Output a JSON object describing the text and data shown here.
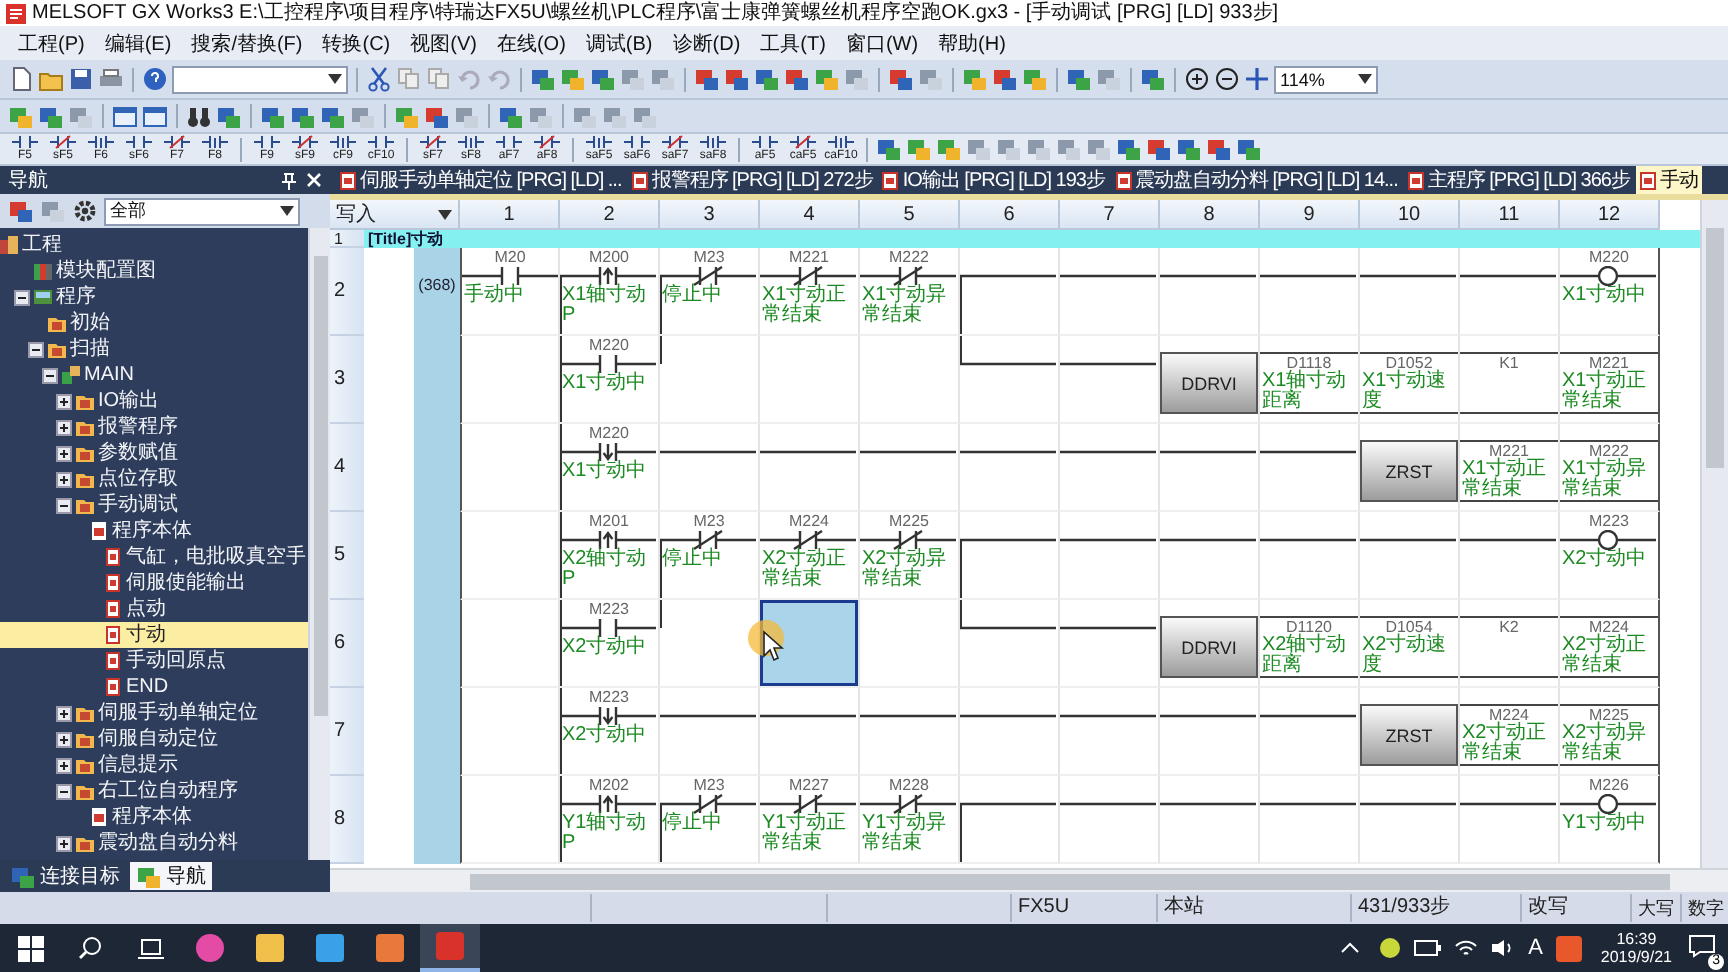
{
  "title_bar": {
    "title": "MELSOFT GX Works3 E:\\工控程序\\项目程序\\特瑞达FX5U\\螺丝机\\PLC程序\\富士康弹簧螺丝机程序空跑OK.gx3 - [手动调试 [PRG] [LD] 933步]"
  },
  "menu": [
    "工程(P)",
    "编辑(E)",
    "搜索/替换(F)",
    "转换(C)",
    "视图(V)",
    "在线(O)",
    "调试(B)",
    "诊断(D)",
    "工具(T)",
    "窗口(W)",
    "帮助(H)"
  ],
  "toolbar": {
    "zoom": "114%",
    "function_keys": [
      "F5",
      "sF5",
      "F6",
      "sF6",
      "F7",
      "F8",
      "F9",
      "sF9",
      "cF9",
      "cF10",
      "sF7",
      "sF8",
      "aF7",
      "aF8",
      "saF5",
      "saF6",
      "saF7",
      "saF8",
      "aF5",
      "caF5",
      "caF10"
    ]
  },
  "navigator": {
    "title": "导航",
    "filter": "全部",
    "tree": [
      {
        "label": "工程",
        "kind": "project",
        "selected": false,
        "children": [
          {
            "label": "模块配置图",
            "kind": "module",
            "selected": false
          },
          {
            "label": "程序",
            "kind": "programs",
            "expanded": true,
            "selected": false,
            "children": [
              {
                "label": "初始",
                "kind": "folder",
                "selected": false
              },
              {
                "label": "扫描",
                "kind": "folder",
                "expanded": true,
                "selected": false,
                "children": [
                  {
                    "label": "MAIN",
                    "kind": "main",
                    "expanded": true,
                    "selected": false,
                    "children": [
                      {
                        "label": "IO输出",
                        "kind": "folder",
                        "expanded": false,
                        "selected": false
                      },
                      {
                        "label": "报警程序",
                        "kind": "folder",
                        "expanded": false,
                        "selected": false
                      },
                      {
                        "label": "参数赋值",
                        "kind": "folder",
                        "expanded": false,
                        "selected": false
                      },
                      {
                        "label": "点位存取",
                        "kind": "folder",
                        "expanded": false,
                        "selected": false
                      },
                      {
                        "label": "手动调试",
                        "kind": "folder",
                        "expanded": true,
                        "selected": false,
                        "children": [
                          {
                            "label": "程序本体",
                            "kind": "program",
                            "selected": false,
                            "children": [
                              {
                                "label": "气缸，电批吸真空手",
                                "kind": "page",
                                "selected": false
                              },
                              {
                                "label": "伺服使能输出",
                                "kind": "page",
                                "selected": false
                              },
                              {
                                "label": "点动",
                                "kind": "page",
                                "selected": false
                              },
                              {
                                "label": "寸动",
                                "kind": "page",
                                "selected": true
                              },
                              {
                                "label": "手动回原点",
                                "kind": "page",
                                "selected": false
                              },
                              {
                                "label": "END",
                                "kind": "page",
                                "selected": false
                              }
                            ]
                          }
                        ]
                      },
                      {
                        "label": "伺服手动单轴定位",
                        "kind": "folder",
                        "expanded": false,
                        "selected": false
                      },
                      {
                        "label": "伺服自动定位",
                        "kind": "folder",
                        "expanded": false,
                        "selected": false
                      },
                      {
                        "label": "信息提示",
                        "kind": "folder",
                        "expanded": false,
                        "selected": false
                      },
                      {
                        "label": "右工位自动程序",
                        "kind": "folder",
                        "expanded": true,
                        "selected": false,
                        "children": [
                          {
                            "label": "程序本体",
                            "kind": "program",
                            "selected": false
                          }
                        ]
                      },
                      {
                        "label": "震动盘自动分料",
                        "kind": "folder",
                        "expanded": false,
                        "selected": false
                      }
                    ]
                  }
                ]
              }
            ]
          }
        ]
      }
    ]
  },
  "doc_tabs": [
    {
      "label": "伺服手动单轴定位 [PRG] [LD] ...",
      "selected": false
    },
    {
      "label": "报警程序 [PRG] [LD] 272步",
      "selected": false
    },
    {
      "label": "IO输出 [PRG] [LD] 193步",
      "selected": false
    },
    {
      "label": "震动盘自动分料 [PRG] [LD] 14...",
      "selected": false
    },
    {
      "label": "主程序 [PRG] [LD] 366步",
      "selected": false
    },
    {
      "label": "手动",
      "selected": true
    }
  ],
  "ladder": {
    "mode": "写入",
    "columns": [
      "1",
      "2",
      "3",
      "4",
      "5",
      "6",
      "7",
      "8",
      "9",
      "10",
      "11",
      "12"
    ],
    "title_row": {
      "number": "1",
      "text": "[Title]寸动"
    },
    "rows": [
      {
        "number": "2",
        "step": "(368)",
        "cells": [
          {
            "kind": "contact",
            "device": "M20",
            "comment": "手动中",
            "drop": false,
            "selected": false
          },
          {
            "kind": "rising",
            "device": "M200",
            "comment": "X1轴寸动P",
            "drop": true,
            "selected": false
          },
          {
            "kind": "contact_nc",
            "device": "M23",
            "comment": "停止中",
            "drop": true,
            "selected": false
          },
          {
            "kind": "contact_nc",
            "device": "M221",
            "comment": "X1寸动正常结束",
            "drop": false,
            "selected": false
          },
          {
            "kind": "contact_nc",
            "device": "M222",
            "comment": "X1寸动异常结束",
            "drop": false,
            "selected": false
          },
          {
            "kind": "wire",
            "drop": true,
            "selected": false
          },
          {
            "kind": "wire",
            "drop": false,
            "selected": false
          },
          {
            "kind": "wire",
            "drop": false,
            "selected": false
          },
          {
            "kind": "wire",
            "drop": false,
            "selected": false
          },
          {
            "kind": "wire",
            "drop": false,
            "selected": false
          },
          {
            "kind": "wire",
            "drop": false,
            "selected": false
          },
          {
            "kind": "coil",
            "device": "M220",
            "comment": "X1寸动中",
            "drop": false,
            "selected": false
          }
        ]
      },
      {
        "number": "3",
        "cells": [
          {
            "kind": "empty",
            "drop": false,
            "selected": false
          },
          {
            "kind": "contact",
            "device": "M220",
            "comment": "X1寸动中",
            "drop": true,
            "selected": false
          },
          {
            "kind": "empty",
            "drop": false,
            "selected": false
          },
          {
            "kind": "empty",
            "drop": false,
            "selected": false
          },
          {
            "kind": "empty",
            "drop": false,
            "selected": false
          },
          {
            "kind": "wire",
            "drop": false,
            "selected": false
          },
          {
            "kind": "wire",
            "drop": false,
            "selected": false
          },
          {
            "kind": "instruction",
            "label": "DDRVI",
            "drop": false,
            "selected": false
          },
          {
            "kind": "operand",
            "device": "D1118",
            "comment": "X1轴寸动距离",
            "drop": false,
            "selected": false
          },
          {
            "kind": "operand",
            "device": "D1052",
            "comment": "X1寸动速度",
            "drop": false,
            "selected": false
          },
          {
            "kind": "operand",
            "device": "K1",
            "drop": false,
            "selected": false
          },
          {
            "kind": "operand",
            "device": "M221",
            "comment": "X1寸动正常结束",
            "drop": false,
            "selected": false
          }
        ]
      },
      {
        "number": "4",
        "cells": [
          {
            "kind": "empty",
            "drop": false,
            "selected": false
          },
          {
            "kind": "falling",
            "device": "M220",
            "comment": "X1寸动中",
            "drop": true,
            "selected": false
          },
          {
            "kind": "wire",
            "drop": false,
            "selected": false
          },
          {
            "kind": "wire",
            "drop": false,
            "selected": false
          },
          {
            "kind": "wire",
            "drop": false,
            "selected": false
          },
          {
            "kind": "wire",
            "drop": false,
            "selected": false
          },
          {
            "kind": "wire",
            "drop": false,
            "selected": false
          },
          {
            "kind": "wire",
            "drop": false,
            "selected": false
          },
          {
            "kind": "wire",
            "drop": false,
            "selected": false
          },
          {
            "kind": "instruction",
            "label": "ZRST",
            "drop": false,
            "selected": false
          },
          {
            "kind": "operand",
            "device": "M221",
            "comment": "X1寸动正常结束",
            "drop": false,
            "selected": false
          },
          {
            "kind": "operand",
            "device": "M222",
            "comment": "X1寸动异常结束",
            "drop": false,
            "selected": false
          }
        ]
      },
      {
        "number": "5",
        "cells": [
          {
            "kind": "empty",
            "drop": false,
            "selected": false
          },
          {
            "kind": "rising",
            "device": "M201",
            "comment": "X2轴寸动P",
            "drop": true,
            "selected": false
          },
          {
            "kind": "contact_nc",
            "device": "M23",
            "comment": "停止中",
            "drop": true,
            "selected": false
          },
          {
            "kind": "contact_nc",
            "device": "M224",
            "comment": "X2寸动正常结束",
            "drop": false,
            "selected": false
          },
          {
            "kind": "contact_nc",
            "device": "M225",
            "comment": "X2寸动异常结束",
            "drop": false,
            "selected": false
          },
          {
            "kind": "wire",
            "drop": true,
            "selected": false
          },
          {
            "kind": "wire",
            "drop": false,
            "selected": false
          },
          {
            "kind": "wire",
            "drop": false,
            "selected": false
          },
          {
            "kind": "wire",
            "drop": false,
            "selected": false
          },
          {
            "kind": "wire",
            "drop": false,
            "selected": false
          },
          {
            "kind": "wire",
            "drop": false,
            "selected": false
          },
          {
            "kind": "coil",
            "device": "M223",
            "comment": "X2寸动中",
            "drop": false,
            "selected": false
          }
        ]
      },
      {
        "number": "6",
        "cells": [
          {
            "kind": "empty",
            "drop": false,
            "selected": false
          },
          {
            "kind": "contact",
            "device": "M223",
            "comment": "X2寸动中",
            "drop": true,
            "selected": false
          },
          {
            "kind": "empty",
            "drop": false,
            "selected": false
          },
          {
            "kind": "empty",
            "drop": false,
            "selected": true
          },
          {
            "kind": "empty",
            "drop": false,
            "selected": false
          },
          {
            "kind": "wire",
            "drop": false,
            "selected": false
          },
          {
            "kind": "wire",
            "drop": false,
            "selected": false
          },
          {
            "kind": "instruction",
            "label": "DDRVI",
            "drop": false,
            "selected": false
          },
          {
            "kind": "operand",
            "device": "D1120",
            "comment": "X2轴寸动距离",
            "drop": false,
            "selected": false
          },
          {
            "kind": "operand",
            "device": "D1054",
            "comment": "X2寸动速度",
            "drop": false,
            "selected": false
          },
          {
            "kind": "operand",
            "device": "K2",
            "drop": false,
            "selected": false
          },
          {
            "kind": "operand",
            "device": "M224",
            "comment": "X2寸动正常结束",
            "drop": false,
            "selected": false
          }
        ]
      },
      {
        "number": "7",
        "cells": [
          {
            "kind": "empty",
            "drop": false,
            "selected": false
          },
          {
            "kind": "falling",
            "device": "M223",
            "comment": "X2寸动中",
            "drop": true,
            "selected": false
          },
          {
            "kind": "wire",
            "drop": false,
            "selected": false
          },
          {
            "kind": "wire",
            "drop": false,
            "selected": false
          },
          {
            "kind": "wire",
            "drop": false,
            "selected": false
          },
          {
            "kind": "wire",
            "drop": false,
            "selected": false
          },
          {
            "kind": "wire",
            "drop": false,
            "selected": false
          },
          {
            "kind": "wire",
            "drop": false,
            "selected": false
          },
          {
            "kind": "wire",
            "drop": false,
            "selected": false
          },
          {
            "kind": "instruction",
            "label": "ZRST",
            "drop": false,
            "selected": false
          },
          {
            "kind": "operand",
            "device": "M224",
            "comment": "X2寸动正常结束",
            "drop": false,
            "selected": false
          },
          {
            "kind": "operand",
            "device": "M225",
            "comment": "X2寸动异常结束",
            "drop": false,
            "selected": false
          }
        ]
      },
      {
        "number": "8",
        "cells": [
          {
            "kind": "empty",
            "drop": false,
            "selected": false
          },
          {
            "kind": "rising",
            "device": "M202",
            "comment": "Y1轴寸动P",
            "drop": true,
            "selected": false
          },
          {
            "kind": "contact_nc",
            "device": "M23",
            "comment": "停止中",
            "drop": true,
            "selected": false
          },
          {
            "kind": "contact_nc",
            "device": "M227",
            "comment": "Y1寸动正常结束",
            "drop": false,
            "selected": false
          },
          {
            "kind": "contact_nc",
            "device": "M228",
            "comment": "Y1寸动异常结束",
            "drop": false,
            "selected": false
          },
          {
            "kind": "wire",
            "drop": true,
            "selected": false
          },
          {
            "kind": "wire",
            "drop": false,
            "selected": false
          },
          {
            "kind": "wire",
            "drop": false,
            "selected": false
          },
          {
            "kind": "wire",
            "drop": false,
            "selected": false
          },
          {
            "kind": "wire",
            "drop": false,
            "selected": false
          },
          {
            "kind": "wire",
            "drop": false,
            "selected": false
          },
          {
            "kind": "coil",
            "device": "M226",
            "comment": "Y1寸动中",
            "drop": false,
            "selected": false
          }
        ]
      }
    ]
  },
  "bottom_tabs": [
    {
      "label": "连接目标",
      "selected": false
    },
    {
      "label": "导航",
      "selected": true
    }
  ],
  "status_bar": [
    "FX5U",
    "本站",
    "431/933步",
    "改写",
    "大写",
    "数字"
  ],
  "taskbar": {
    "input_method": "A",
    "time": "16:39",
    "date": "2019/9/21",
    "notifications": "3"
  }
}
